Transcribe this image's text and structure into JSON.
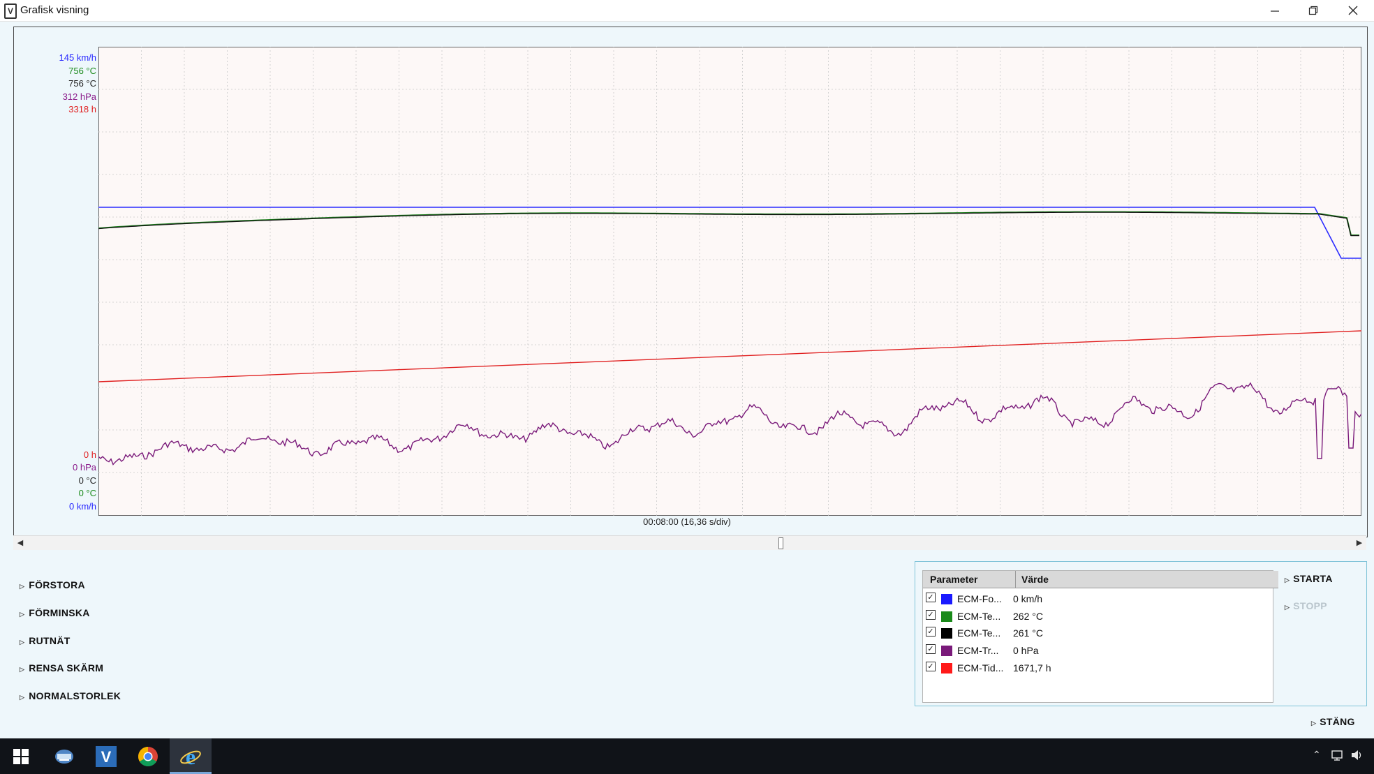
{
  "window": {
    "title": "Grafisk visning",
    "min_icon": "minimize-icon",
    "max_icon": "restore-icon",
    "close_icon": "close-icon"
  },
  "graph": {
    "scale_top": [
      {
        "text": "145 km/h",
        "color": "#2828ff"
      },
      {
        "text": "756 °C",
        "color": "#1a8a1a"
      },
      {
        "text": "756 °C",
        "color": "#222222"
      },
      {
        "text": "312 hPa",
        "color": "#8a1a8a"
      },
      {
        "text": "3318 h",
        "color": "#e02020"
      }
    ],
    "scale_bottom": [
      {
        "text": "0 h",
        "color": "#e02020"
      },
      {
        "text": "0 hPa",
        "color": "#8a1a8a"
      },
      {
        "text": "0 °C",
        "color": "#222222"
      },
      {
        "text": "0 °C",
        "color": "#1a8a1a"
      },
      {
        "text": "0 km/h",
        "color": "#2828ff"
      }
    ],
    "x_label": "00:08:00 (16,36 s/div)"
  },
  "menu": {
    "items": [
      {
        "label": "FÖRSTORA"
      },
      {
        "label": "FÖRMINSKA"
      },
      {
        "label": "RUTNÄT"
      },
      {
        "label": "RENSA SKÄRM"
      },
      {
        "label": "NORMALSTORLEK"
      }
    ]
  },
  "params": {
    "header_param": "Parameter",
    "header_value": "Värde",
    "rows": [
      {
        "name": "ECM-Fo...",
        "value": "0 km/h",
        "color": "#1a1aff",
        "checked": "✓"
      },
      {
        "name": "ECM-Te...",
        "value": "262 °C",
        "color": "#1a8a1a",
        "checked": "✓"
      },
      {
        "name": "ECM-Te...",
        "value": "261 °C",
        "color": "#000000",
        "checked": "✓"
      },
      {
        "name": "ECM-Tr...",
        "value": "0 hPa",
        "color": "#7a1a7a",
        "checked": "✓"
      },
      {
        "name": "ECM-Tid...",
        "value": "1671,7 h",
        "color": "#ff1a1a",
        "checked": "✓"
      }
    ]
  },
  "actions": {
    "start": "STARTA",
    "stop": "STOPP",
    "close": "STÄNG"
  },
  "taskbar": {
    "icons": [
      "windows-start-icon",
      "network-icon",
      "vida-app-icon",
      "chrome-icon",
      "internet-explorer-icon"
    ]
  }
}
